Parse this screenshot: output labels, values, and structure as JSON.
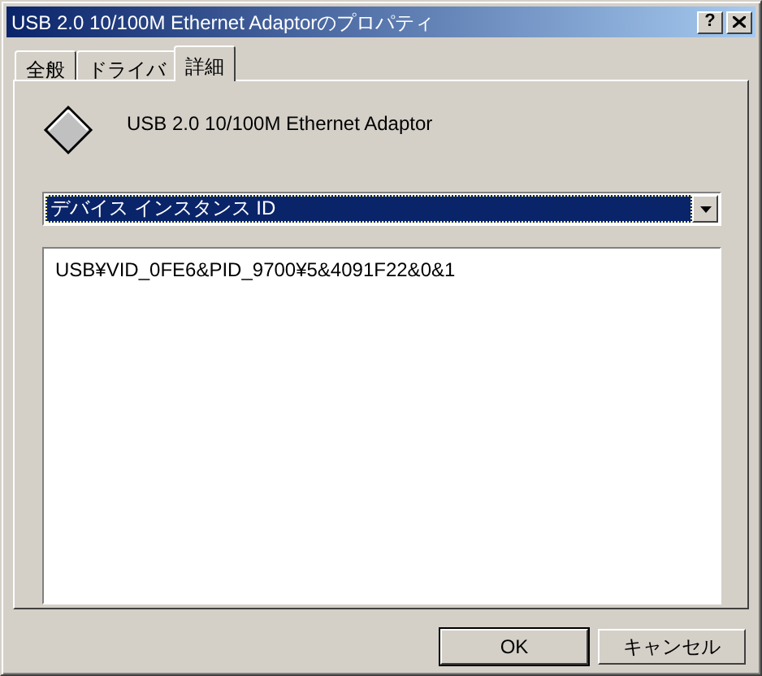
{
  "window": {
    "title": "USB 2.0 10/100M Ethernet Adaptorのプロパティ",
    "help_button": "?"
  },
  "tabs": [
    {
      "label": "全般",
      "selected": false
    },
    {
      "label": "ドライバ",
      "selected": false
    },
    {
      "label": "詳細",
      "selected": true
    }
  ],
  "device": {
    "name": "USB 2.0 10/100M Ethernet Adaptor"
  },
  "property_select": {
    "value": "デバイス インスタンス ID"
  },
  "values_list": {
    "items": [
      "USB¥VID_0FE6&PID_9700¥5&4091F22&0&1"
    ]
  },
  "buttons": [
    {
      "label": "OK",
      "default": true
    },
    {
      "label": "キャンセル",
      "default": false
    }
  ]
}
